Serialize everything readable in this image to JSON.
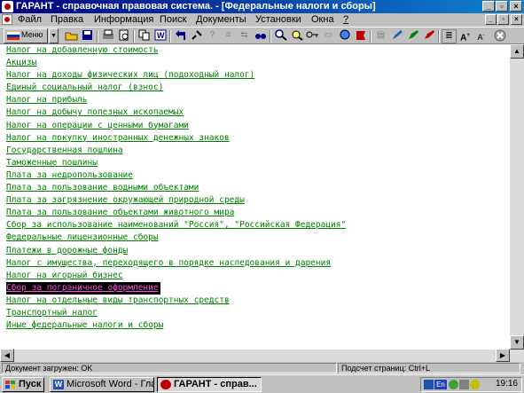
{
  "window": {
    "title": "ГАРАНТ - справочная правовая система. - [Федеральные налоги и сборы]"
  },
  "menu": {
    "items": [
      "Файл",
      "Правка",
      "Информация",
      "Поиск",
      "Документы",
      "Установки",
      "Окна",
      "?"
    ]
  },
  "toolbar": {
    "menu_button_label": "Меню"
  },
  "document": {
    "items": [
      "Налог на добавленную стоимость",
      "Акцизы",
      "Налог на доходы физических лиц (подоходный налог)",
      "Единый социальный налог (взнос)",
      "Налог на прибыль",
      "Налог на добычу полезных ископаемых",
      "Налог на операции с ценными бумагами",
      "Налог на покупку иностранных денежных знаков",
      "Государственная пошлина",
      "Таможенные пошлины",
      "Плата за недропользование",
      "Плата за пользование водными объектами",
      "Плата за загрязнение окружающей природной среды",
      "Плата за пользование объектами животного мира",
      "Сбор за использование наименований \"Россия\", \"Российская Федерация\"",
      "Федеральные лицензионные сборы",
      "Платежи в дорожные фонды",
      "Налог с имущества, переходящего в порядке наследования и дарения",
      "Налог на игорный бизнес",
      "Сбор за пограничное оформление",
      "Налог на отдельные виды транспортных средств",
      "Транспортный налог",
      "Иные федеральные налоги и сборы"
    ],
    "selected_index": 19
  },
  "statusbar": {
    "left": "Документ загружен: OK",
    "right": "Подсчет страниц: Ctrl+L"
  },
  "taskbar": {
    "start_label": "Пуск",
    "tasks": [
      "Microsoft Word - Гла...",
      "ГАРАНТ - справ..."
    ],
    "tray_lang": "En",
    "clock": "19:16"
  },
  "colors": {
    "link": "#008000",
    "selected_bg": "#000000",
    "selected_fg": "#ff4fe0",
    "title_start": "#000080",
    "title_end": "#1084d0"
  }
}
